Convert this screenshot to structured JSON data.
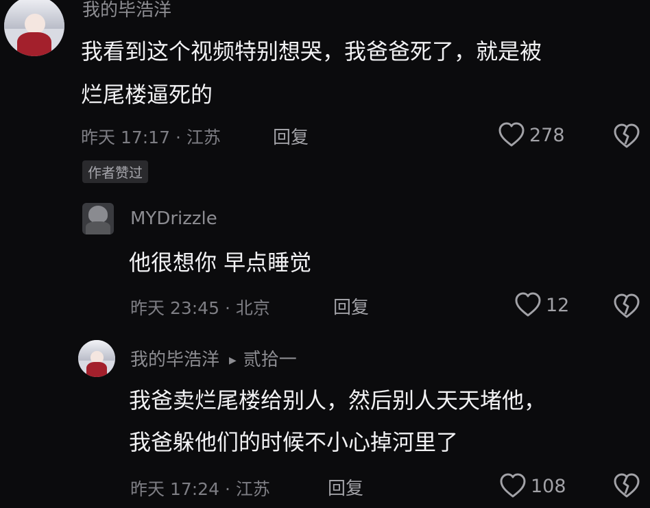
{
  "comments": [
    {
      "username": "我的毕浩洋",
      "lines": [
        "我看到这个视频特别想哭，我爸爸死了，就是被",
        "烂尾楼逼死的"
      ],
      "meta": "昨天 17:17 · 江苏",
      "reply_label": "回复",
      "likes": "278",
      "badge": "作者赞过"
    },
    {
      "username": "MYDrizzle",
      "lines": [
        "他很想你 早点睡觉"
      ],
      "meta": "昨天 23:45 · 北京",
      "reply_label": "回复",
      "likes": "12"
    },
    {
      "username": "我的毕浩洋",
      "reply_to": "贰拾一",
      "lines": [
        "我爸卖烂尾楼给别人，然后别人天天堵他，",
        "我爸躲他们的时候不小心掉河里了"
      ],
      "meta": "昨天 17:24 · 江苏",
      "reply_label": "回复",
      "likes": "108"
    }
  ],
  "icons": {
    "like": "heart-outline-icon",
    "dislike": "broken-heart-icon",
    "reply_arrow": "triangle-right-icon"
  },
  "colors": {
    "background": "#0b0b0d",
    "text": "#f2f2f4",
    "secondary": "#8d8d92"
  }
}
